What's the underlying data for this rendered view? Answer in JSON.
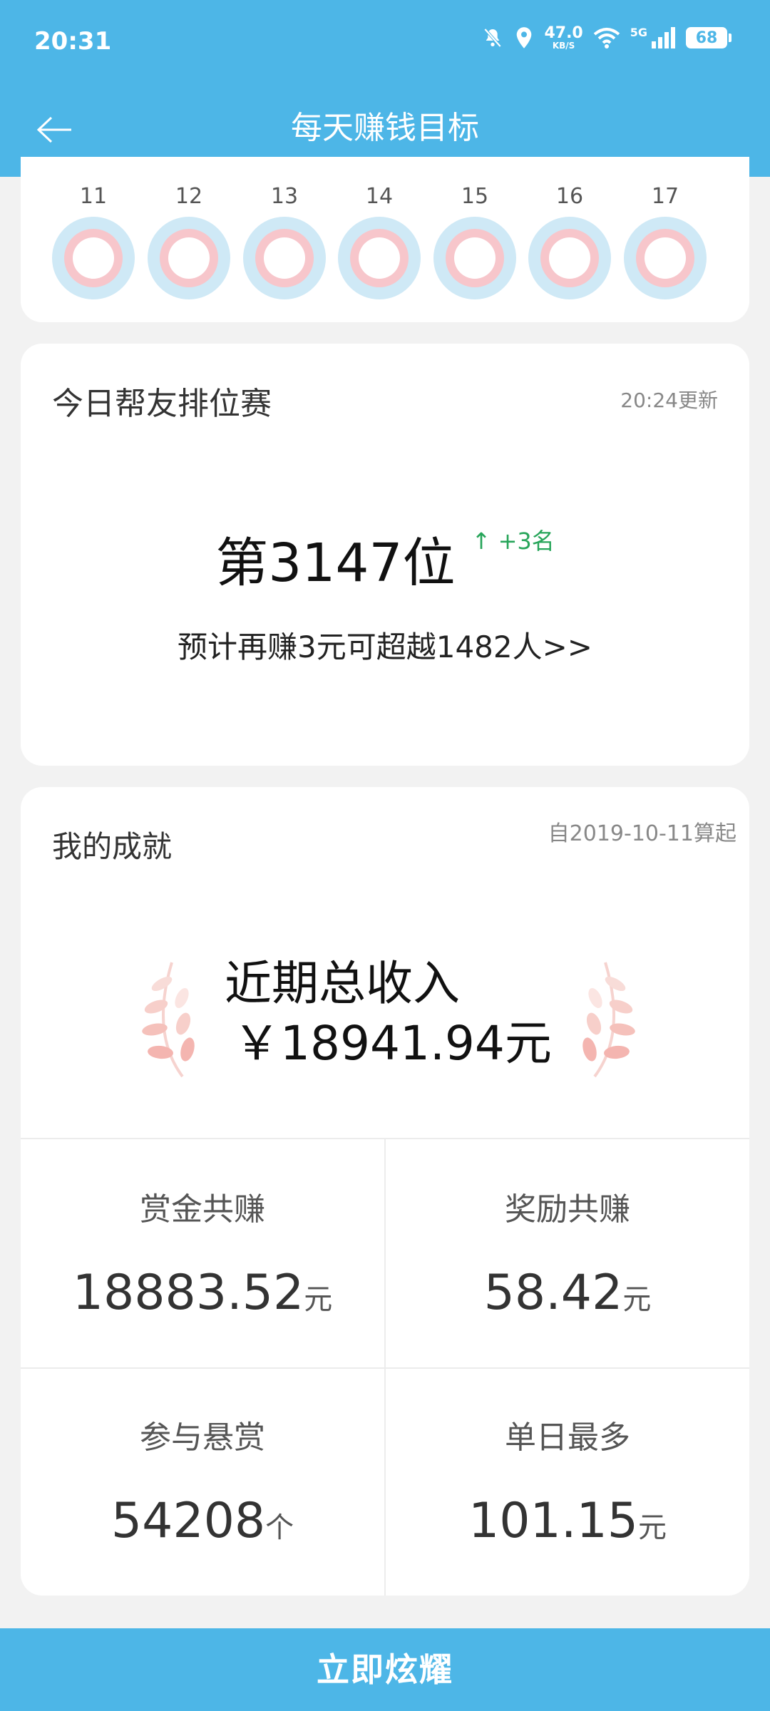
{
  "status_bar": {
    "time": "20:31",
    "net_speed": "47.0",
    "net_unit": "KB/S",
    "network": "5G",
    "battery": "68"
  },
  "header": {
    "title": "每天赚钱目标"
  },
  "week": {
    "days": [
      "11",
      "12",
      "13",
      "14",
      "15",
      "16",
      "17"
    ]
  },
  "ranking": {
    "title": "今日帮友排位赛",
    "updated": "20:24更新",
    "rank": "第3147位",
    "change": "↑ +3名",
    "hint": "预计再赚3元可超越1482人>>"
  },
  "achievements": {
    "title": "我的成就",
    "since": "自2019-10-11算起",
    "income_title": "近期总收入",
    "income_amount": "￥18941.94元",
    "stats": [
      {
        "label": "赏金共赚",
        "value": "18883.52",
        "unit": "元"
      },
      {
        "label": "奖励共赚",
        "value": "58.42",
        "unit": "元"
      },
      {
        "label": "参与悬赏",
        "value": "54208",
        "unit": "个"
      },
      {
        "label": "单日最多",
        "value": "101.15",
        "unit": "元"
      }
    ]
  },
  "footer": {
    "button": "立即炫耀"
  },
  "colors": {
    "primary": "#4db6e7",
    "ring_outer": "#cfe9f6",
    "ring_inner": "#f7c6cb",
    "up_green": "#27a55a",
    "laurel": "#f4b5b0"
  }
}
